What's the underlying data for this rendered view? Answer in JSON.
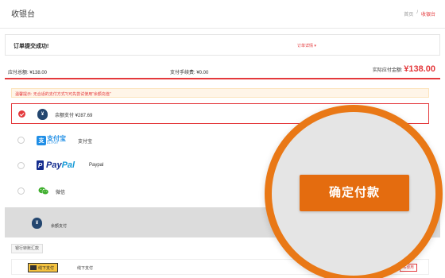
{
  "header": {
    "title": "收银台",
    "breadcrumb": [
      "首页",
      "/",
      "收银台"
    ]
  },
  "submit": {
    "message": "订单提交成功!",
    "detail_link": "订单详情 ▾"
  },
  "amounts": {
    "due_label": "应付总额: ¥138.00",
    "fee_label": "支付手续费: ¥0.00",
    "actual_label": "实际应付金额:",
    "actual_value": "¥138.00"
  },
  "notice": "温馨提示: 无合适的支付方式?(可先尝试使用“余额充值”",
  "pay_options": [
    {
      "name": "balance",
      "label": "余额支付 ¥287.69",
      "selected": true,
      "icon": "money-bag-icon"
    },
    {
      "name": "alipay",
      "label": "支付宝",
      "selected": false,
      "icon": "alipay-logo",
      "logo_cn": "支付宝",
      "logo_en": "ALIPAY"
    },
    {
      "name": "paypal",
      "label": "Paypal",
      "selected": false,
      "icon": "paypal-logo",
      "logo_a": "Pay",
      "logo_b": "Pal"
    },
    {
      "name": "wechat",
      "label": "微信",
      "selected": false,
      "icon": "wechat-icon"
    }
  ],
  "grey_panel": {
    "label": "余额支付"
  },
  "bank": {
    "tab": "银行转账汇款",
    "offline_icon_text": "线下支付",
    "offline_label": "线下支付",
    "use_button": "去使用"
  },
  "confirm_button": "确定付款",
  "colors": {
    "accent": "#e4393c",
    "orange": "#e46c0f",
    "magnifier_ring": "#e97816"
  }
}
